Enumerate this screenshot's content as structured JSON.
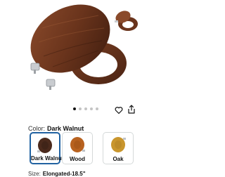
{
  "gallery": {
    "image_count": 5,
    "active_index": 0,
    "wishlist_icon": "heart-icon",
    "share_icon": "share-icon"
  },
  "color": {
    "label": "Color:",
    "selected_value": "Dark Walnut",
    "options": [
      {
        "label": "Dark Walnut",
        "swatch_color": "#4b2a1c",
        "selected": true
      },
      {
        "label": "Wood",
        "swatch_color": "#b8621f",
        "selected": false
      },
      {
        "label": "Oak",
        "swatch_color": "#c9962d",
        "selected": false
      }
    ]
  },
  "size": {
    "label": "Size:",
    "selected_value": "Elongated-18.5\""
  },
  "colors": {
    "selected_border": "#2162a1",
    "dot_active": "#111111",
    "dot_inactive": "#c4c4c4"
  }
}
